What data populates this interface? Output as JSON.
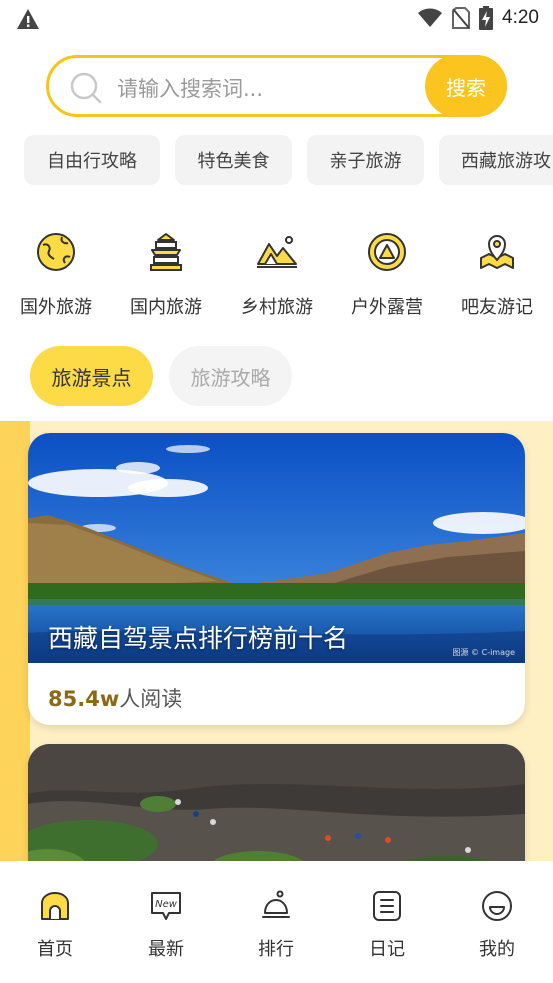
{
  "status_bar": {
    "time": "4:20",
    "icons": [
      "warning-icon",
      "wifi-icon",
      "no-sim-icon",
      "battery-charging-icon"
    ]
  },
  "search": {
    "placeholder": "请输入搜索词...",
    "button_label": "搜索"
  },
  "chips": [
    "自由行攻略",
    "特色美食",
    "亲子旅游",
    "西藏旅游攻"
  ],
  "categories": [
    {
      "label": "国外旅游",
      "icon": "globe-icon"
    },
    {
      "label": "国内旅游",
      "icon": "temple-icon"
    },
    {
      "label": "乡村旅游",
      "icon": "mountain-tent-icon"
    },
    {
      "label": "户外露营",
      "icon": "camping-tent-icon"
    },
    {
      "label": "吧友游记",
      "icon": "map-pin-icon"
    }
  ],
  "tabs": [
    {
      "label": "旅游景点",
      "active": true
    },
    {
      "label": "旅游攻略",
      "active": false
    }
  ],
  "feed": {
    "cards": [
      {
        "title": "西藏自驾景点排行榜前十名",
        "reads_number": "85.4w",
        "reads_suffix": "人阅读",
        "watermark": "图源 © C-image"
      },
      {
        "title": "",
        "image": "hillside-hikers-photo"
      }
    ]
  },
  "bottom_nav": [
    {
      "label": "首页",
      "icon": "home-icon",
      "active": true
    },
    {
      "label": "最新",
      "icon": "new-badge-icon",
      "active": false
    },
    {
      "label": "排行",
      "icon": "ranking-icon",
      "active": false
    },
    {
      "label": "日记",
      "icon": "diary-icon",
      "active": false
    },
    {
      "label": "我的",
      "icon": "profile-icon",
      "active": false
    }
  ],
  "colors": {
    "accent": "#fcc41e",
    "accent_light": "#fddb47",
    "feed_bg": "#fef0c3",
    "reads_number": "#8a6a14"
  }
}
